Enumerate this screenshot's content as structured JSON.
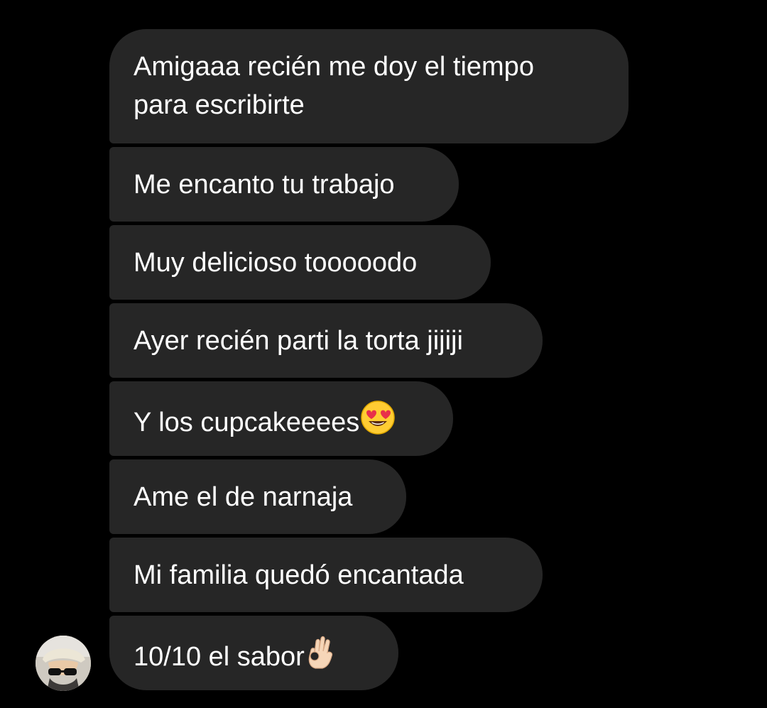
{
  "chat": {
    "messages": [
      {
        "text": "Amigaaa recién me doy el tiempo\npara escribirte",
        "emoji": ""
      },
      {
        "text": "Me encanto tu trabajo",
        "emoji": ""
      },
      {
        "text": "Muy delicioso tooooodo",
        "emoji": ""
      },
      {
        "text": "Ayer recién parti la torta jijiji",
        "emoji": ""
      },
      {
        "text": "Y los cupcakeeees",
        "emoji": "heart-eyes-emoji"
      },
      {
        "text": "Ame el de narnaja",
        "emoji": ""
      },
      {
        "text": "Mi familia quedó encantada",
        "emoji": ""
      },
      {
        "text": "10/10 el sabor",
        "emoji": "ok-hand-emoji"
      }
    ]
  },
  "colors": {
    "background": "#000000",
    "bubble": "#262626",
    "text": "#ffffff"
  },
  "sender": {
    "avatar_icon": "profile-photo-avatar"
  }
}
